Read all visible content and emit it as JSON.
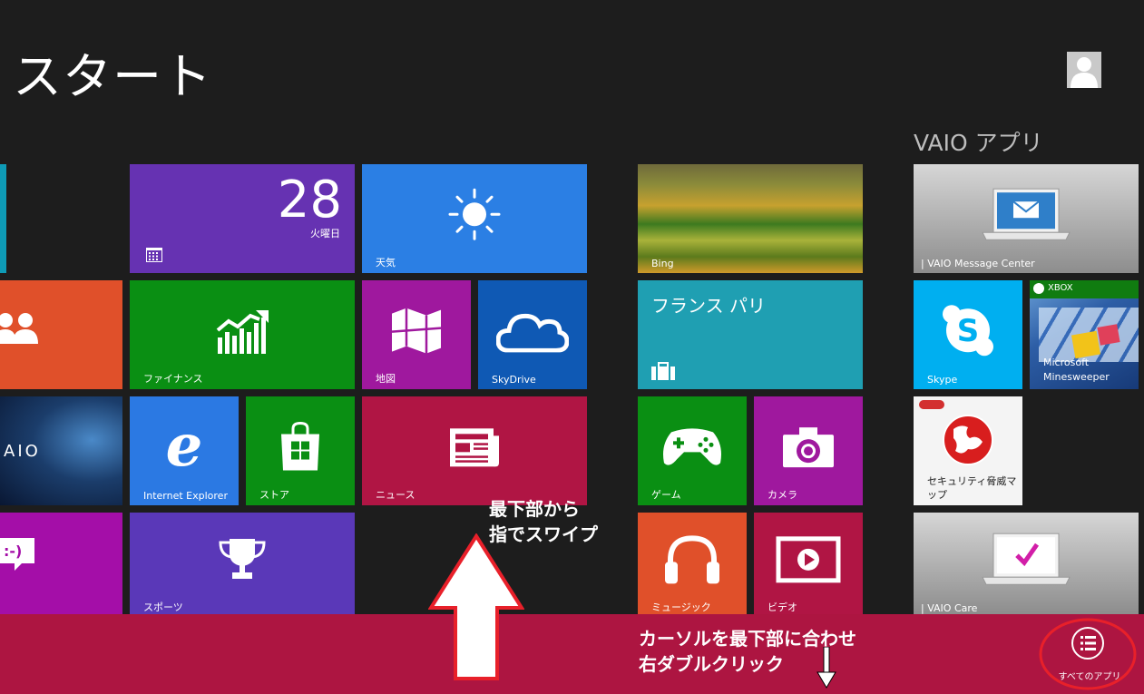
{
  "screen": {
    "title": "スタート",
    "group_title": "VAIO アプリ"
  },
  "tiles": {
    "calendar_day": "28",
    "calendar_weekday": "火曜日",
    "weather": "天気",
    "bing": "Bing",
    "vaio_message_center": "| VAIO Message Center",
    "finance": "ファイナンス",
    "maps": "地図",
    "skydrive": "SkyDrive",
    "travel": "フランス パリ",
    "skype": "Skype",
    "xbox_badge": "XBOX",
    "minesweeper_line1": "Microsoft",
    "minesweeper_line2": "Minesweeper",
    "internet_explorer": "Internet Explorer",
    "store": "ストア",
    "news": "ニュース",
    "games": "ゲーム",
    "camera": "カメラ",
    "security_map": "セキュリティ脅威マップ",
    "sports": "スポーツ",
    "music": "ミュージック",
    "video": "ビデオ",
    "vaio_care": "| VAIO Care",
    "vaio_logo": "AIO"
  },
  "annotations": {
    "swipe_line1": "最下部から",
    "swipe_line2": "指でスワイプ",
    "cursor_line1": "カーソルを最下部に合わせ",
    "cursor_line2": "右ダブルクリック"
  },
  "app_bar": {
    "all_apps_label": "すべてのアプリ"
  },
  "colors": {
    "background": "#1d1d1d",
    "app_bar": "#ad1541",
    "highlight_ring": "#e8202a",
    "arrow_outline": "#e8202a"
  },
  "icons": {
    "user": "user-avatar-icon",
    "all_apps": "list-icon",
    "weather": "sun-icon"
  }
}
